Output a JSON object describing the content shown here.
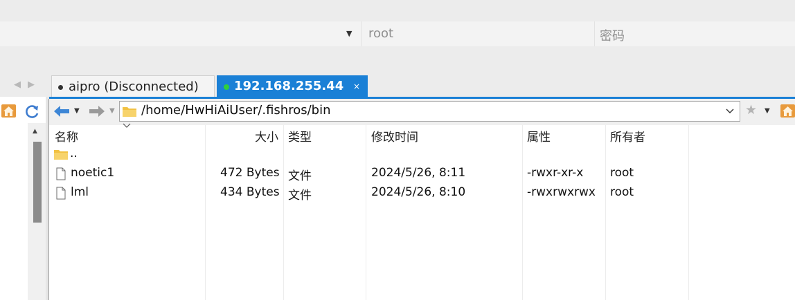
{
  "connection": {
    "username": "root",
    "password_placeholder": "密码"
  },
  "tabs": [
    {
      "label": "aipro (Disconnected)",
      "status": "disconnected"
    },
    {
      "label": "192.168.255.44",
      "status": "connected",
      "close": "×"
    }
  ],
  "toolbar": {
    "path": "/home/HwHiAiUser/.fishros/bin"
  },
  "file_list": {
    "columns": [
      "名称",
      "大小",
      "类型",
      "修改时间",
      "属性",
      "所有者"
    ],
    "parent_dir": "..",
    "rows": [
      {
        "name": "noetic1",
        "size": "472 Bytes",
        "type": "文件",
        "modified": "2024/5/26, 8:11",
        "attributes": "-rwxr-xr-x",
        "owner": "root"
      },
      {
        "name": "lml",
        "size": "434 Bytes",
        "type": "文件",
        "modified": "2024/5/26, 8:10",
        "attributes": "-rwxrwxrwx",
        "owner": "root"
      }
    ]
  },
  "colors": {
    "accent": "#1a80d6",
    "connected_dot": "#2fcf3d",
    "folder": "#f2c243",
    "home_icon": "#e89a3c",
    "refresh_icon": "#3d7ccf"
  }
}
